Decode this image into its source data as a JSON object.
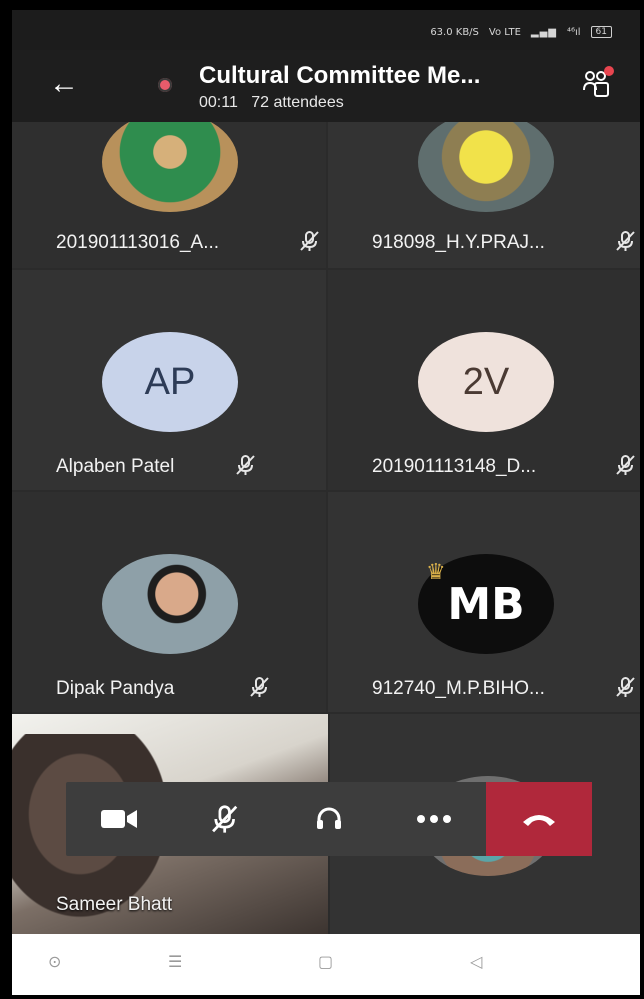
{
  "status_bar": {
    "speed": "63.0 KB/S",
    "volte": "Vo LTE",
    "signal_text": "⁴⁶ıl",
    "battery": "61"
  },
  "header": {
    "title": "Cultural Committee Me...",
    "elapsed": "00:11",
    "attendees": "72 attendees",
    "recording_color": "#e85b6b"
  },
  "participants": [
    {
      "name": "201901113016_A...",
      "avatar_type": "photo",
      "muted": true
    },
    {
      "name": "918098_H.Y.PRAJ...",
      "avatar_type": "photo",
      "muted": true
    },
    {
      "name": "Alpaben Patel",
      "avatar_type": "initials",
      "initials": "AP",
      "avatar_bg": "#c8d3ea",
      "muted": true
    },
    {
      "name": "201901113148_D...",
      "avatar_type": "initials",
      "initials": "2V",
      "avatar_bg": "#efe2dc",
      "muted": true
    },
    {
      "name": "Dipak  Pandya",
      "avatar_type": "photo",
      "muted": true
    },
    {
      "name": "912740_M.P.BIHO...",
      "avatar_type": "logo",
      "logo_text": "MB",
      "muted": true
    },
    {
      "name": "Sameer Bhatt",
      "avatar_type": "video",
      "muted": false
    }
  ],
  "controls": {
    "camera": "video-camera-icon",
    "mic": "mic-off-icon",
    "audio": "headset-icon",
    "more": "more-icon",
    "hangup": "hang-up-icon",
    "hangup_color": "#b0283b"
  },
  "navbar": [
    "circle-icon",
    "menu-icon",
    "square-icon",
    "back-triangle-icon"
  ]
}
